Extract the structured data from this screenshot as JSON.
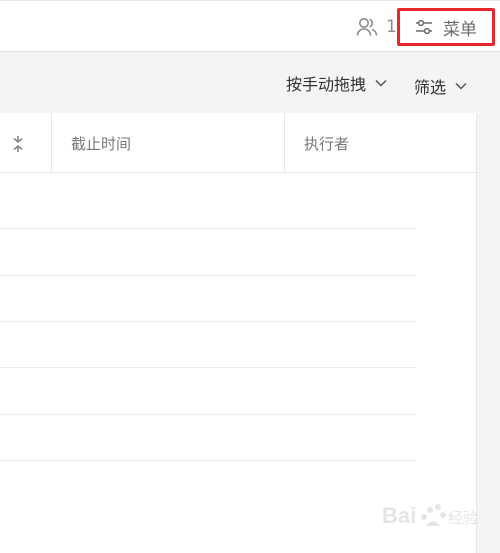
{
  "topbar": {
    "member_count": "1",
    "member_icon": "users-icon",
    "menu_label": "菜单",
    "menu_icon": "sliders-icon"
  },
  "toolbar": {
    "sort_label": "按手动拖拽",
    "filter_label": "筛选"
  },
  "table": {
    "columns": [
      "截止时间",
      "执行者"
    ],
    "row_count": 6
  },
  "colors": {
    "highlight_border": "#e5262b",
    "background": "#f3f4f6",
    "panel": "#ffffff"
  },
  "watermark": {
    "text": "Bai 经验"
  }
}
